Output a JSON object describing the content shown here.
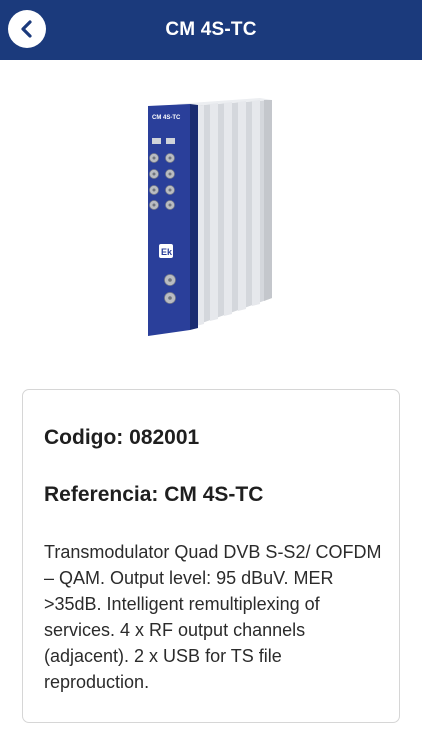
{
  "header": {
    "title": "CM 4S-TC"
  },
  "product_image": {
    "label": "CM 4S-TC",
    "logo": "Ek"
  },
  "card": {
    "code_label": "Codigo: 082001",
    "reference_label": "Referencia: CM 4S-TC",
    "description": "Transmodulator Quad DVB S-S2/ COFDM – QAM. Output level: 95 dBuV. MER >35dB. Intelligent remultiplexing of services. 4 x RF output channels (adjacent). 2 x USB for TS file reproduction."
  },
  "colors": {
    "header_bg": "#1b3a7c",
    "device_blue": "#2a3f9a"
  }
}
